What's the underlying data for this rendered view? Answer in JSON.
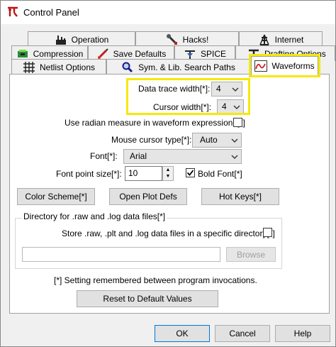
{
  "window": {
    "title": "Control Panel"
  },
  "tabs": {
    "row1": [
      {
        "label": "Operation",
        "icon": "operation-icon"
      },
      {
        "label": "Hacks!",
        "icon": "hacks-icon"
      },
      {
        "label": "Internet",
        "icon": "internet-icon"
      }
    ],
    "row2": [
      {
        "label": "Compression",
        "icon": "compression-icon"
      },
      {
        "label": "Save Defaults",
        "icon": "save-defaults-icon"
      },
      {
        "label": "SPICE",
        "icon": "spice-icon"
      },
      {
        "label": "Drafting Options",
        "icon": "drafting-icon"
      }
    ],
    "row3": [
      {
        "label": "Netlist Options",
        "icon": "netlist-icon"
      },
      {
        "label": "Sym. & Lib. Search Paths",
        "icon": "search-paths-icon"
      },
      {
        "label": "Waveforms",
        "icon": "waveforms-icon",
        "active": true
      }
    ]
  },
  "waveforms": {
    "data_trace_width_label": "Data trace width[*]:",
    "data_trace_width_value": "4",
    "cursor_width_label": "Cursor width[*]:",
    "cursor_width_value": "4",
    "radian_label": "Use radian measure in waveform expressions[*]",
    "mouse_cursor_label": "Mouse cursor type[*]:",
    "mouse_cursor_value": "Auto",
    "font_label": "Font[*]:",
    "font_value": "Arial",
    "font_size_label": "Font point size[*]:",
    "font_size_value": "10",
    "bold_font_label": "Bold Font[*]",
    "bold_font_checked": true,
    "color_scheme_button": "Color Scheme[*]",
    "open_plot_defs_button": "Open Plot Defs",
    "hot_keys_button": "Hot Keys[*]",
    "directory_group_title": "Directory for .raw and .log data files[*]",
    "store_specific_dir_label": "Store .raw, .plt and .log data files in a specific directory[*]",
    "directory_value": "",
    "browse_button": "Browse",
    "note": "[*] Setting remembered between program invocations.",
    "reset_button": "Reset to Default Values"
  },
  "footer": {
    "ok": "OK",
    "cancel": "Cancel",
    "help": "Help"
  },
  "colors": {
    "highlight": "#f5e80b",
    "ok_border": "#0078d7"
  }
}
